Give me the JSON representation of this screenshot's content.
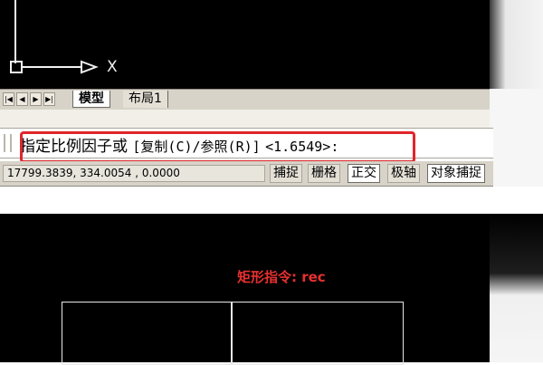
{
  "model_space": {
    "ucs_x_label": "X"
  },
  "tabs": {
    "nav": [
      "|◀",
      "◀",
      "▶",
      "▶|"
    ],
    "items": [
      {
        "label": "模型",
        "active": true
      },
      {
        "label": "布局1",
        "active": false
      }
    ]
  },
  "command_line": {
    "prompt": "指定比例因子或",
    "options": "[复制(C)/参照(R)]",
    "default_value": "<1.6549>",
    "suffix": ":"
  },
  "status_bar": {
    "coordinates": "17799.3839,  334.0054 ,  0.0000",
    "buttons": [
      {
        "label": "捕捉",
        "on": false
      },
      {
        "label": "栅格",
        "on": false
      },
      {
        "label": "正交",
        "on": true
      },
      {
        "label": "极轴",
        "on": false
      },
      {
        "label": "对象捕捉",
        "on": true
      }
    ]
  },
  "drawing": {
    "annotation": "矩形指令: rec"
  },
  "colors": {
    "highlight": "#e0262b",
    "annotation": "#e83030",
    "canvas": "#000000"
  }
}
